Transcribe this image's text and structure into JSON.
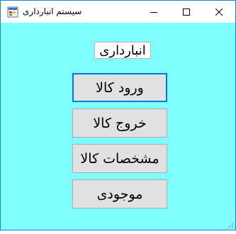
{
  "window": {
    "title": "سیستم انبارداری",
    "controls": {
      "minimize_icon": "minimize-icon",
      "maximize_icon": "maximize-icon",
      "close_icon": "close-icon"
    }
  },
  "main": {
    "heading": "انبارداری",
    "buttons": [
      {
        "label": "ورود کالا",
        "focused": true
      },
      {
        "label": "خروج کالا",
        "focused": false
      },
      {
        "label": "مشخصات کالا",
        "focused": false
      },
      {
        "label": "موجودی",
        "focused": false
      }
    ]
  },
  "colors": {
    "form_background": "#80ffff",
    "button_face": "#e1e1e1",
    "focus_border": "#0078d7",
    "window_border": "#1a7fd8"
  }
}
